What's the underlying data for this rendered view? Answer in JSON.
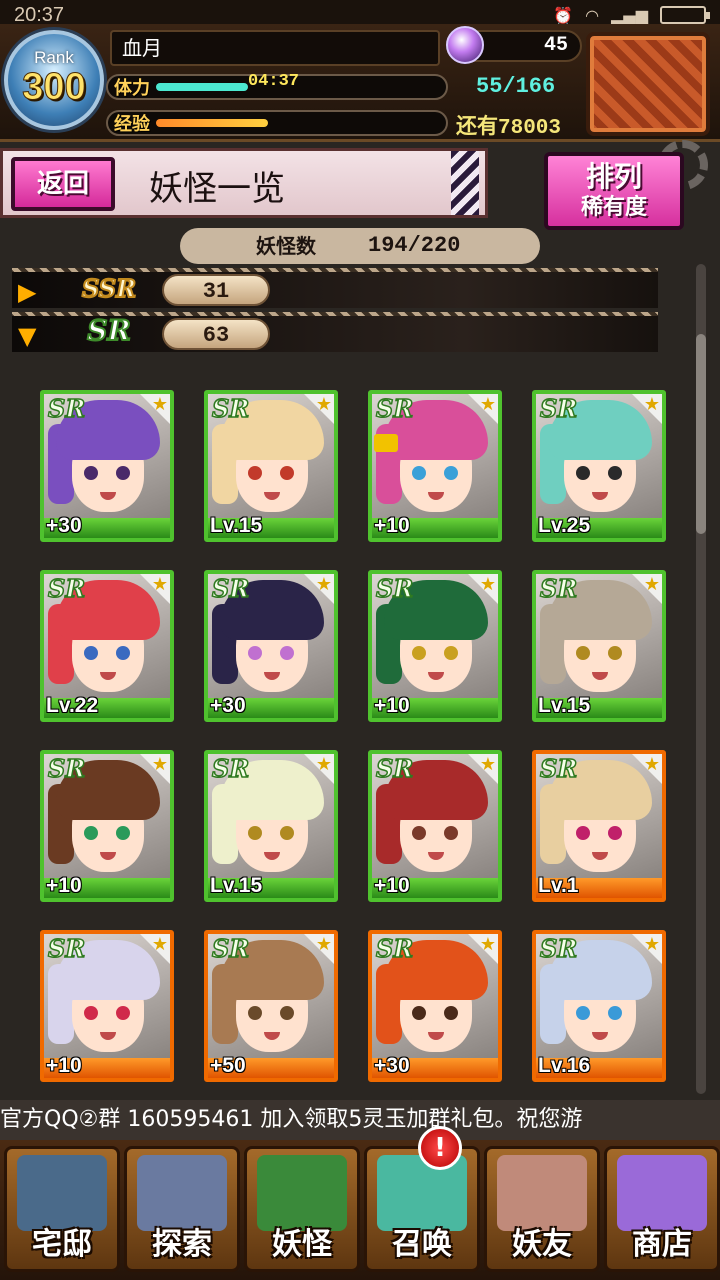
{
  "status": {
    "time": "20:37",
    "network": "4G\n1X"
  },
  "player": {
    "rank_label": "Rank",
    "rank": "300",
    "name": "血月",
    "stamina_label": "体力",
    "stamina_timer": "04:37",
    "stamina_value": "55/166",
    "stamina_fraction": 0.33,
    "exp_label": "经验",
    "exp_remaining": "还有78003",
    "exp_fraction": 0.4,
    "gems": "45"
  },
  "header": {
    "back_label": "返回",
    "title": "妖怪一览",
    "sort_label": "排列",
    "sort_value": "稀有度"
  },
  "collection": {
    "label": "妖怪数",
    "value": "194/220"
  },
  "rarity_groups": [
    {
      "tag": "SSR",
      "count": "31",
      "expanded": false
    },
    {
      "tag": "SR",
      "count": "63",
      "expanded": true
    }
  ],
  "cards": [
    {
      "rarity": "SR",
      "label": "+30",
      "frame": "green",
      "hair": "#7a4fbf",
      "eye": "#4a2a6a"
    },
    {
      "rarity": "SR",
      "label": "Lv.15",
      "frame": "green",
      "hair": "#f1d6a2",
      "eye": "#c23a2a"
    },
    {
      "rarity": "SR",
      "label": "+10",
      "frame": "green",
      "hair": "#d94f9a",
      "eye": "#3aa0d8",
      "locked": true
    },
    {
      "rarity": "SR",
      "label": "Lv.25",
      "frame": "green",
      "hair": "#6fcfc0",
      "eye": "#2a2a2a"
    },
    {
      "rarity": "SR",
      "label": "Lv.22",
      "frame": "green",
      "hair": "#e0404a",
      "eye": "#3a6ac0"
    },
    {
      "rarity": "SR",
      "label": "+30",
      "frame": "green",
      "hair": "#2a2448",
      "eye": "#c070d0"
    },
    {
      "rarity": "SR",
      "label": "+10",
      "frame": "green",
      "hair": "#1f6b3a",
      "eye": "#c9a020"
    },
    {
      "rarity": "SR",
      "label": "Lv.15",
      "frame": "green",
      "hair": "#b5a896",
      "eye": "#b08a20"
    },
    {
      "rarity": "SR",
      "label": "+10",
      "frame": "green",
      "hair": "#6a3a22",
      "eye": "#2a9a5a"
    },
    {
      "rarity": "SR",
      "label": "Lv.15",
      "frame": "green",
      "hair": "#eef0cc",
      "eye": "#b08a20"
    },
    {
      "rarity": "SR",
      "label": "+10",
      "frame": "green",
      "hair": "#a82a2a",
      "eye": "#7a3a2a"
    },
    {
      "rarity": "SR",
      "label": "Lv.1",
      "frame": "orange",
      "hair": "#e8cfa0",
      "eye": "#c0206a"
    },
    {
      "rarity": "SR",
      "label": "+10",
      "frame": "orange",
      "hair": "#d8d4ec",
      "eye": "#d02a4a"
    },
    {
      "rarity": "SR",
      "label": "+50",
      "frame": "orange",
      "hair": "#a87a52",
      "eye": "#6a4a2a"
    },
    {
      "rarity": "SR",
      "label": "+30",
      "frame": "orange",
      "hair": "#e2521a",
      "eye": "#4a2a1a"
    },
    {
      "rarity": "SR",
      "label": "Lv.16",
      "frame": "orange",
      "hair": "#c6d2ea",
      "eye": "#3a9ad8"
    }
  ],
  "ticker": "官方QQ②群 160595461   加入领取5灵玉加群礼包。祝您游",
  "nav": [
    {
      "label": "宅邸",
      "color": "#4a6a8a"
    },
    {
      "label": "探索",
      "color": "#6a7aa0"
    },
    {
      "label": "妖怪",
      "color": "#3a8a3a"
    },
    {
      "label": "召唤",
      "color": "#4ab8a0"
    },
    {
      "label": "妖友",
      "color": "#c08a7a"
    },
    {
      "label": "商店",
      "color": "#9a6ad8"
    }
  ],
  "nav_alert": "!"
}
